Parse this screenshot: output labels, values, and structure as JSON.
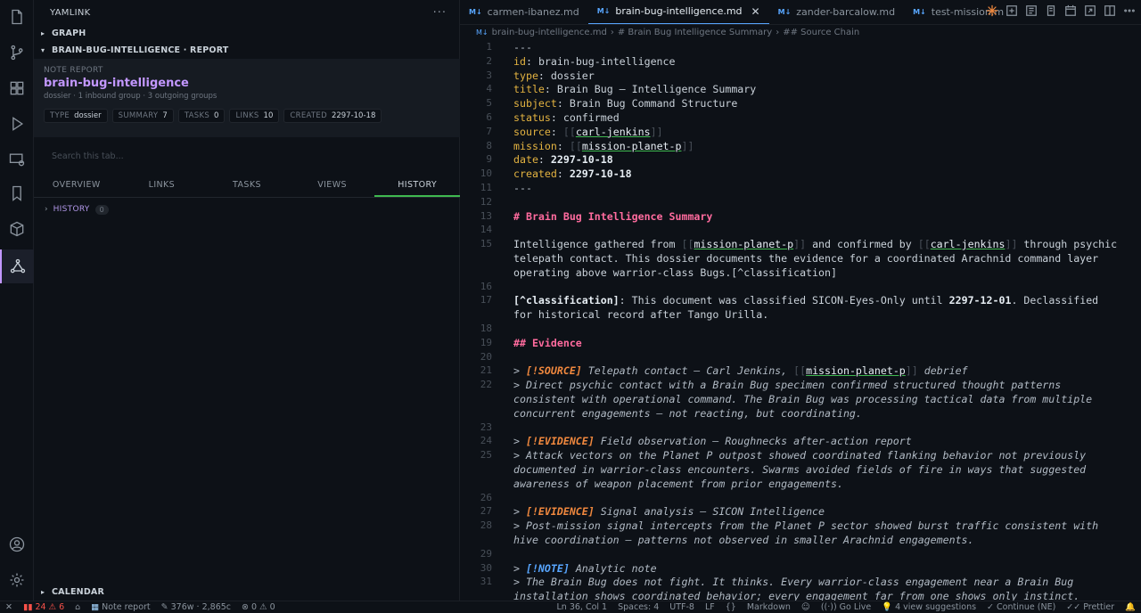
{
  "sidebar": {
    "title": "YAMLINK",
    "graph_label": "GRAPH",
    "report_section_label": "BRAIN-BUG-INTELLIGENCE · REPORT",
    "card": {
      "kicker": "NOTE REPORT",
      "title": "brain-bug-intelligence",
      "sub": "dossier · 1 inbound group · 3 outgoing groups",
      "chips": [
        {
          "k": "TYPE",
          "v": "dossier"
        },
        {
          "k": "SUMMARY",
          "v": "7"
        },
        {
          "k": "TASKS",
          "v": "0"
        },
        {
          "k": "LINKS",
          "v": "10"
        },
        {
          "k": "CREATED",
          "v": "2297-10-18"
        }
      ]
    },
    "search_placeholder": "Search this tab...",
    "tabs": [
      "OVERVIEW",
      "LINKS",
      "TASKS",
      "VIEWS",
      "HISTORY"
    ],
    "history_label": "HISTORY",
    "history_count": "0",
    "calendar_label": "CALENDAR"
  },
  "editor": {
    "tabs": [
      {
        "label": "carmen-ibanez.md"
      },
      {
        "label": "brain-bug-intelligence.md"
      },
      {
        "label": "zander-barcalow.md"
      },
      {
        "label": "test-mission.m"
      }
    ],
    "breadcrumb": [
      "brain-bug-intelligence.md",
      "# Brain Bug Intelligence Summary",
      "## Source Chain"
    ],
    "lines": [
      {
        "n": "1",
        "t": "---"
      },
      {
        "n": "2",
        "key": "id",
        "val": "brain-bug-intelligence"
      },
      {
        "n": "3",
        "key": "type",
        "val": "dossier"
      },
      {
        "n": "4",
        "key": "title",
        "val": "Brain Bug — Intelligence Summary"
      },
      {
        "n": "5",
        "key": "subject",
        "val": "Brain Bug Command Structure"
      },
      {
        "n": "6",
        "key": "status",
        "val": "confirmed"
      },
      {
        "n": "7",
        "key": "source",
        "link": "carl-jenkins"
      },
      {
        "n": "8",
        "key": "mission",
        "link": "mission-planet-p"
      },
      {
        "n": "9",
        "key": "date",
        "num": "2297-10-18"
      },
      {
        "n": "10",
        "key": "created",
        "num": "2297-10-18"
      },
      {
        "n": "11",
        "t": "---"
      },
      {
        "n": "12",
        "t": ""
      },
      {
        "n": "13",
        "h": "# Brain Bug Intelligence Summary"
      },
      {
        "n": "14",
        "t": ""
      },
      {
        "n": "15",
        "p1": "Intelligence gathered from ",
        "l1": "mission-planet-p",
        "p2": " and confirmed by ",
        "l2": "carl-jenkins",
        "p3": " through psychic"
      },
      {
        "n": "",
        "t": "telepath contact. This dossier documents the evidence for a coordinated Arachnid command layer"
      },
      {
        "n": "",
        "t": "operating above warrior-class Bugs.[^classification]"
      },
      {
        "n": "16",
        "t": ""
      },
      {
        "n": "17",
        "fn": "[^classification]",
        "fr": ": This document was classified SICON-Eyes-Only until ",
        "fd": "2297-12-01",
        "fe": ". Declassified"
      },
      {
        "n": "",
        "t": "for historical record after Tango Urilla."
      },
      {
        "n": "18",
        "t": ""
      },
      {
        "n": "19",
        "h": "## Evidence"
      },
      {
        "n": "20",
        "t": ""
      },
      {
        "n": "21",
        "cq": "> ",
        "ct": "[!SOURCE]",
        "cs": "s",
        "ci": " Telepath contact — Carl Jenkins, ",
        "cl": "mission-planet-p",
        "ce": " debrief"
      },
      {
        "n": "22",
        "q": "> Direct psychic contact with a Brain Bug specimen confirmed structured thought patterns"
      },
      {
        "n": "",
        "q": "consistent with operational command. The Brain Bug was processing tactical data from multiple"
      },
      {
        "n": "",
        "q": "concurrent engagements — not reacting, but coordinating."
      },
      {
        "n": "23",
        "t": ""
      },
      {
        "n": "24",
        "cq": "> ",
        "ct": "[!EVIDENCE]",
        "cs": "s",
        "ci": " Field observation — Roughnecks after-action report"
      },
      {
        "n": "25",
        "q": "> Attack vectors on the Planet P outpost showed coordinated flanking behavior not previously"
      },
      {
        "n": "",
        "q": "documented in warrior-class encounters. Swarms avoided fields of fire in ways that suggested"
      },
      {
        "n": "",
        "q": "awareness of weapon placement from prior engagements."
      },
      {
        "n": "26",
        "t": ""
      },
      {
        "n": "27",
        "cq": "> ",
        "ct": "[!EVIDENCE]",
        "cs": "s",
        "ci": " Signal analysis — SICON Intelligence"
      },
      {
        "n": "28",
        "q": "> Post-mission signal intercepts from the Planet P sector showed burst traffic consistent with"
      },
      {
        "n": "",
        "q": "hive coordination — patterns not observed in smaller Arachnid engagements."
      },
      {
        "n": "29",
        "t": ""
      },
      {
        "n": "30",
        "cq": "> ",
        "ct": "[!NOTE]",
        "cs": "n",
        "ci": " Analytic note"
      },
      {
        "n": "31",
        "q": "> The Brain Bug does not fight. It thinks. Every warrior-class engagement near a Brain Bug"
      },
      {
        "n": "",
        "q": "installation shows coordinated behavior; every engagement far from one shows only instinct."
      }
    ]
  },
  "status": {
    "errors": "24",
    "warnings": "6",
    "note_report": "Note report",
    "words": "376w · 2,865c",
    "problems": "0",
    "problems2": "0",
    "position": "Ln 36, Col 1",
    "spaces": "Spaces: 4",
    "encoding": "UTF-8",
    "eol": "LF",
    "braces": "{}",
    "language": "Markdown",
    "golive": "Go Live",
    "suggestions": "4 view suggestions",
    "continue": "Continue (NE)",
    "prettier": "Prettier"
  }
}
